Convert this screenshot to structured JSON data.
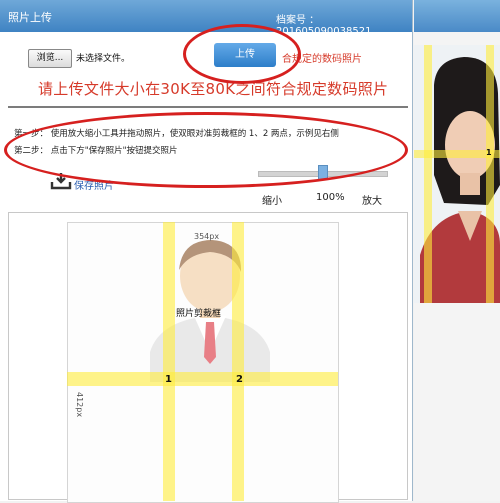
{
  "header": {
    "title": "照片上传",
    "file_number": "档案号 ： 201605090038521"
  },
  "upload": {
    "browse_label": "浏览...",
    "file_status": "未选择文件。",
    "upload_label": "上传",
    "hint_small": "合规定的数码照片",
    "hint_big": "请上传文件大小在30K至80K之间符合规定数码照片"
  },
  "steps": {
    "step1": "第一步：   使用放大缩小工具并拖动照片，使双眼对准剪裁框的 1、2 两点，示例见右侧",
    "step2": "第二步：   点击下方\"保存照片\"按钮提交照片"
  },
  "toolbar": {
    "save_label": "保存照片",
    "zoom_shrink": "缩小",
    "zoom_percent": "100%",
    "zoom_enlarge": "放大",
    "zoom_level": 0.5
  },
  "crop": {
    "width_label": "354px",
    "height_label": "412px",
    "frame_label": "照片剪裁框",
    "marker_1": "1",
    "marker_2": "2"
  },
  "preview": {
    "marker": "1"
  },
  "colors": {
    "accent_blue": "#3f83c3",
    "hint_red": "#d63a2a",
    "guide_yellow": "#ffec3c",
    "annotation_red": "#d6201f"
  }
}
